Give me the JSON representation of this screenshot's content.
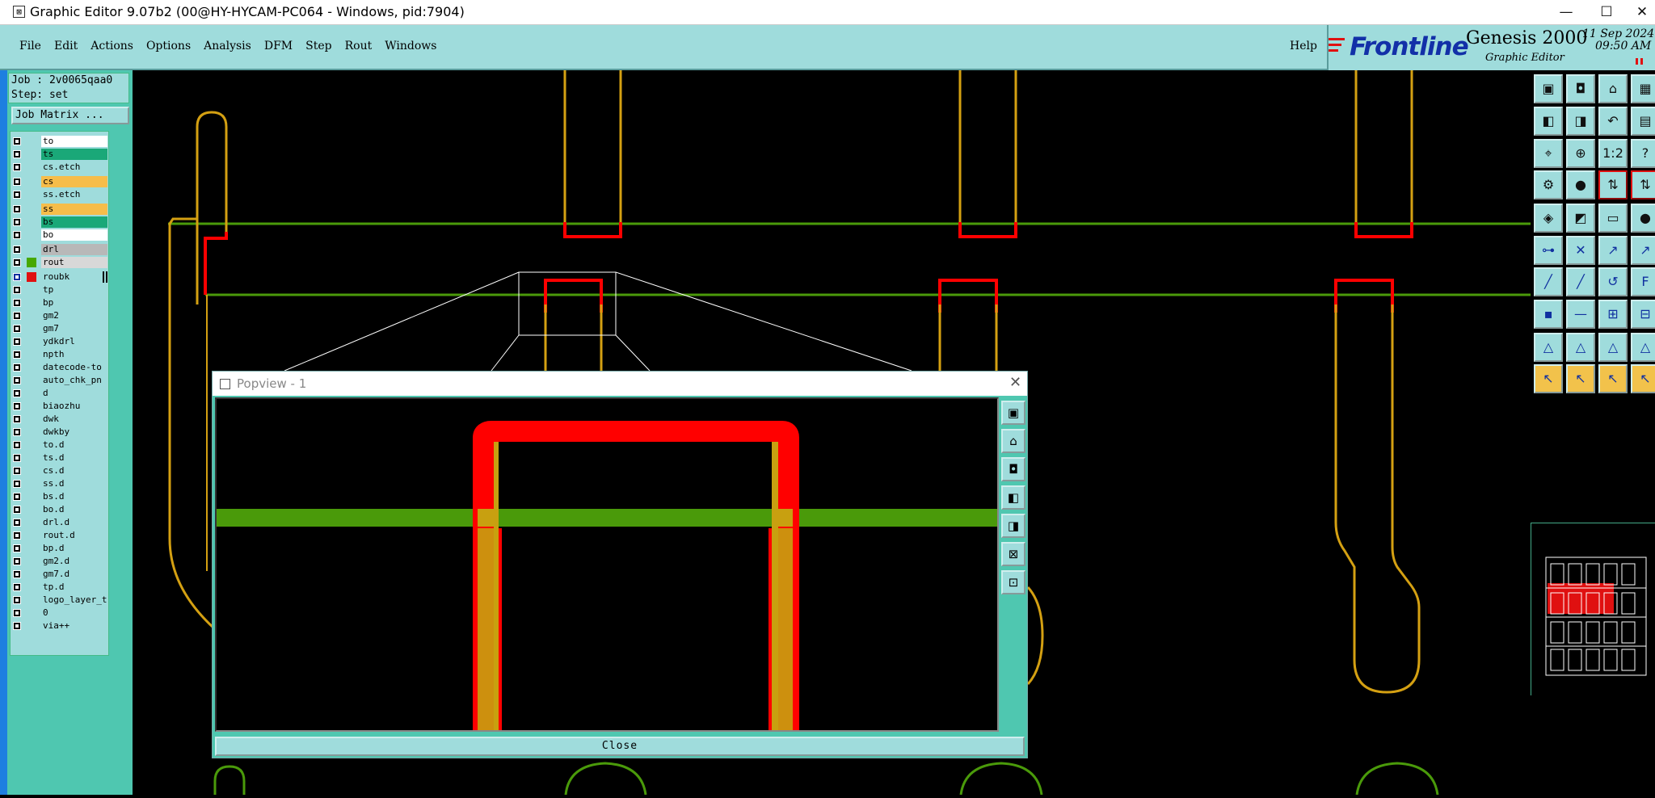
{
  "window": {
    "title": "Graphic Editor 9.07b2 (00@HY-HYCAM-PC064 - Windows, pid:7904)",
    "minimize": "—",
    "maximize": "☐",
    "close": "✕"
  },
  "menu": {
    "items": [
      "File",
      "Edit",
      "Actions",
      "Options",
      "Analysis",
      "DFM",
      "Step",
      "Rout",
      "Windows"
    ],
    "help": "Help"
  },
  "brand": {
    "logo": "Frontline",
    "product": "Genesis 2000",
    "subtitle": "Graphic Editor",
    "date": "11 Sep 2024",
    "time": "09:50 AM"
  },
  "job": {
    "job_line": "Job : 2v0065qaa0",
    "step_line": "Step: set",
    "matrix_button": "Job Matrix ..."
  },
  "layers": [
    {
      "name": "to",
      "bg": "#ffffff"
    },
    {
      "name": "ts",
      "bg": "#1aa878"
    },
    {
      "name": "cs.etch",
      "bg": "#9fdcdc"
    },
    {
      "name": "cs",
      "bg": "#f6bd4a"
    },
    {
      "name": "ss.etch",
      "bg": "#9fdcdc"
    },
    {
      "name": "ss",
      "bg": "#f6bd4a"
    },
    {
      "name": "bs",
      "bg": "#1aa878"
    },
    {
      "name": "bo",
      "bg": "#ffffff"
    },
    {
      "name": "drl",
      "bg": "#b8b8b8"
    },
    {
      "name": "rout",
      "bg": "#d8d8d8",
      "swatch": "#47a800"
    },
    {
      "name": "roubk",
      "bg": "#9fdcdc",
      "swatch": "#e01010",
      "active": true
    },
    {
      "name": "tp",
      "bg": "#9fdcdc"
    },
    {
      "name": "bp",
      "bg": "#9fdcdc"
    },
    {
      "name": "gm2",
      "bg": "#9fdcdc"
    },
    {
      "name": "gm7",
      "bg": "#9fdcdc"
    },
    {
      "name": "ydkdrl",
      "bg": "#9fdcdc"
    },
    {
      "name": "npth",
      "bg": "#9fdcdc"
    },
    {
      "name": "datecode-to",
      "bg": "#9fdcdc"
    },
    {
      "name": "auto_chk_pn",
      "bg": "#9fdcdc"
    },
    {
      "name": "d",
      "bg": "#9fdcdc"
    },
    {
      "name": "biaozhu",
      "bg": "#9fdcdc"
    },
    {
      "name": "dwk",
      "bg": "#9fdcdc"
    },
    {
      "name": "dwkby",
      "bg": "#9fdcdc"
    },
    {
      "name": "to.d",
      "bg": "#9fdcdc"
    },
    {
      "name": "ts.d",
      "bg": "#9fdcdc"
    },
    {
      "name": "cs.d",
      "bg": "#9fdcdc"
    },
    {
      "name": "ss.d",
      "bg": "#9fdcdc"
    },
    {
      "name": "bs.d",
      "bg": "#9fdcdc"
    },
    {
      "name": "bo.d",
      "bg": "#9fdcdc"
    },
    {
      "name": "drl.d",
      "bg": "#9fdcdc"
    },
    {
      "name": "rout.d",
      "bg": "#9fdcdc"
    },
    {
      "name": "bp.d",
      "bg": "#9fdcdc"
    },
    {
      "name": "gm2.d",
      "bg": "#9fdcdc"
    },
    {
      "name": "gm7.d",
      "bg": "#9fdcdc"
    },
    {
      "name": "tp.d",
      "bg": "#9fdcdc"
    },
    {
      "name": "logo_layer_t",
      "bg": "#9fdcdc"
    },
    {
      "name": "0",
      "bg": "#9fdcdc"
    },
    {
      "name": "via++",
      "bg": "#9fdcdc"
    }
  ],
  "popview": {
    "title": "Popview - 1",
    "close_button": "Close"
  },
  "colors": {
    "rout_line": "#4a9a0a",
    "roubk_line": "#ff0000",
    "outline": "#d4a012",
    "panel": "#9fdcdc",
    "panel_dark": "#4fc7b0"
  }
}
